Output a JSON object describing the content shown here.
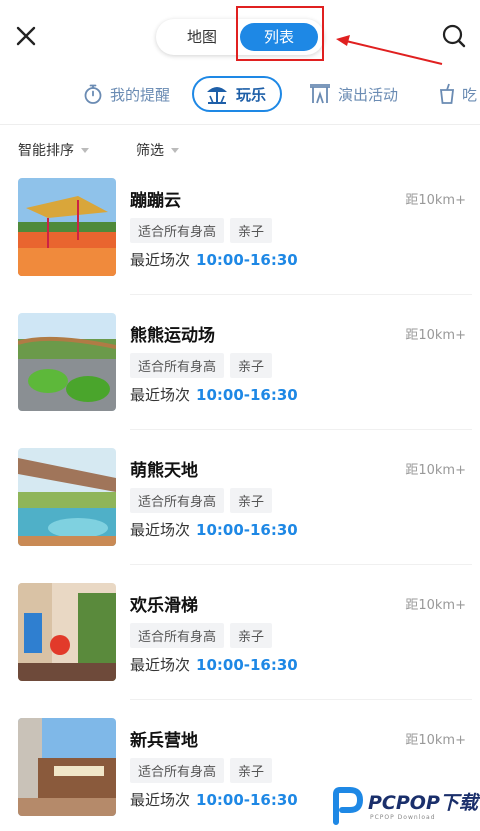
{
  "header": {
    "tabs": [
      {
        "label": "地图",
        "active": false
      },
      {
        "label": "列表",
        "active": true
      }
    ]
  },
  "categories": [
    {
      "label": "我的提醒",
      "icon": "stopwatch-icon",
      "active": false
    },
    {
      "label": "玩乐",
      "icon": "umbrella-play-icon",
      "active": true
    },
    {
      "label": "演出活动",
      "icon": "performance-icon",
      "active": false
    },
    {
      "label": "吃",
      "icon": "drink-cup-icon",
      "active": false
    }
  ],
  "filters": {
    "sort_label": "智能排序",
    "filter_label": "筛选"
  },
  "items": [
    {
      "title": "蹦蹦云",
      "distance": "距10km+",
      "tags": [
        "适合所有身高",
        "亲子"
      ],
      "session_label": "最近场次",
      "session_time": "10:00-16:30"
    },
    {
      "title": "熊熊运动场",
      "distance": "距10km+",
      "tags": [
        "适合所有身高",
        "亲子"
      ],
      "session_label": "最近场次",
      "session_time": "10:00-16:30"
    },
    {
      "title": "萌熊天地",
      "distance": "距10km+",
      "tags": [
        "适合所有身高",
        "亲子"
      ],
      "session_label": "最近场次",
      "session_time": "10:00-16:30"
    },
    {
      "title": "欢乐滑梯",
      "distance": "距10km+",
      "tags": [
        "适合所有身高",
        "亲子"
      ],
      "session_label": "最近场次",
      "session_time": "10:00-16:30"
    },
    {
      "title": "新兵营地",
      "distance": "距10km+",
      "tags": [
        "适合所有身高",
        "亲子"
      ],
      "session_label": "最近场次",
      "session_time": "10:00-16:30"
    }
  ],
  "watermark": {
    "text": "PCPOP下载",
    "sub": "PCPOP Download"
  },
  "colors": {
    "accent": "#1e88e5",
    "annotation_red": "#e02020",
    "category_text": "#6a8bb3"
  }
}
